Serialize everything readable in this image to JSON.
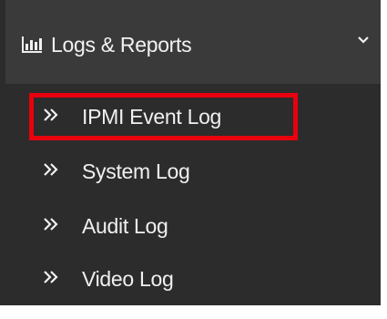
{
  "menu": {
    "section": {
      "icon": "bar-chart-icon",
      "label": "Logs & Reports",
      "expand_icon": "chevron-down-icon"
    },
    "items": [
      {
        "label": "IPMI Event Log",
        "icon": "double-chevron-right-icon",
        "highlighted": true
      },
      {
        "label": "System Log",
        "icon": "double-chevron-right-icon"
      },
      {
        "label": "Audit Log",
        "icon": "double-chevron-right-icon"
      },
      {
        "label": "Video Log",
        "icon": "double-chevron-right-icon"
      }
    ]
  },
  "colors": {
    "header_bg": "#3a3a3a",
    "submenu_bg": "#2c2c2c",
    "text": "#f0f0f0",
    "highlight_border": "#e8000f"
  }
}
